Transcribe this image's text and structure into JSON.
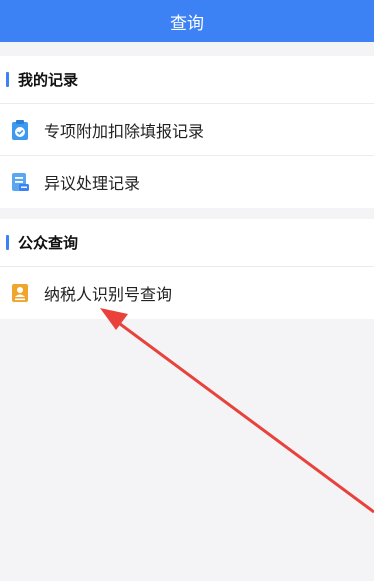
{
  "header": {
    "title": "查询"
  },
  "sections": [
    {
      "title": "我的记录",
      "items": [
        {
          "label": "专项附加扣除填报记录",
          "icon": "clipboard-check-icon"
        },
        {
          "label": "异议处理记录",
          "icon": "document-list-icon"
        }
      ]
    },
    {
      "title": "公众查询",
      "items": [
        {
          "label": "纳税人识别号查询",
          "icon": "person-id-icon"
        }
      ]
    }
  ],
  "colors": {
    "accent": "#3d82f5",
    "icon_orange": "#f0a52c",
    "arrow_red": "#e8423a"
  }
}
